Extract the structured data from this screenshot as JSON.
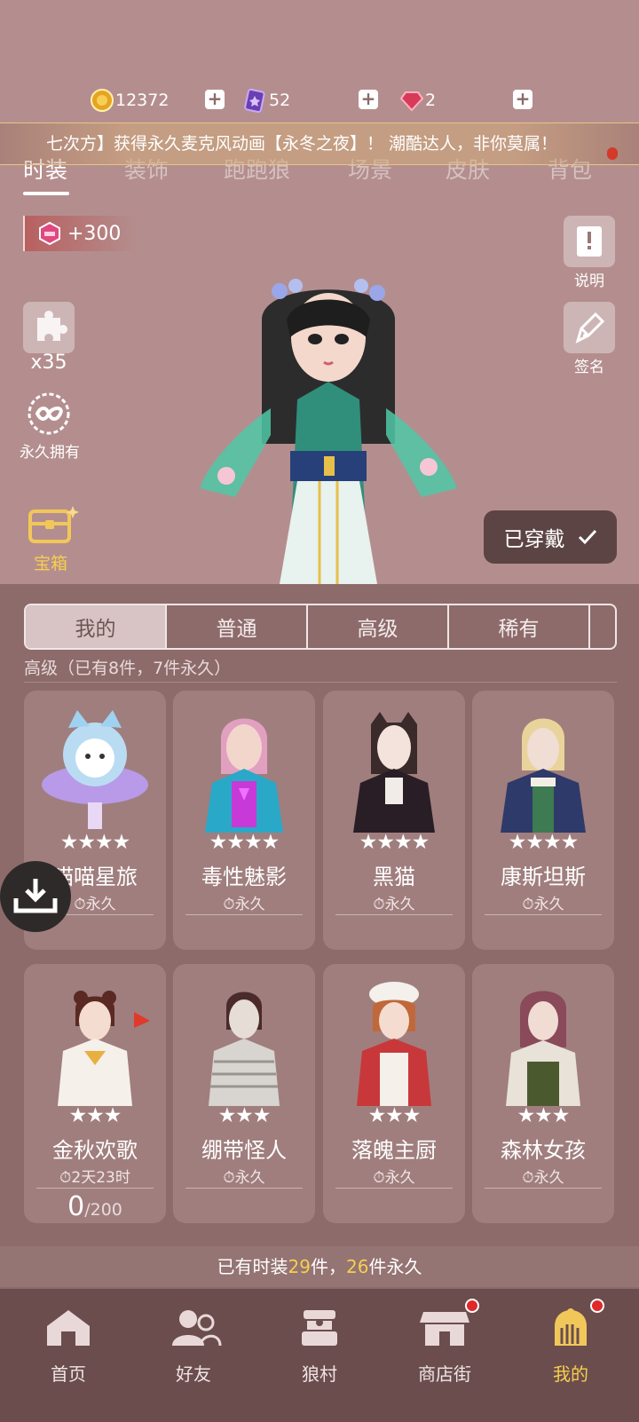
{
  "currency": [
    {
      "icon": "gold-coin-icon",
      "value": "12372"
    },
    {
      "icon": "purple-card-icon",
      "value": "52"
    },
    {
      "icon": "red-gem-icon",
      "value": "2"
    }
  ],
  "announcement": "七次方】获得永久麦克风动画【永冬之夜】！ 潮酷达人，非你莫属！",
  "top_tabs": [
    "时装",
    "装饰",
    "跑跑狼",
    "场景",
    "皮肤",
    "背包"
  ],
  "bonus": "+300",
  "side_left": {
    "puzzle_count": "x35",
    "permanent_label": "永久拥有",
    "chest_label": "宝箱"
  },
  "side_right": {
    "info_label": "说明",
    "sign_label": "签名"
  },
  "worn_button": "已穿戴",
  "filters": [
    "我的",
    "普通",
    "高级",
    "稀有"
  ],
  "section_header": "高级（已有8件，7件永久）",
  "cards": [
    {
      "name": "喵喵星旅",
      "stars": "★★★★",
      "status": "永久"
    },
    {
      "name": "毒性魅影",
      "stars": "★★★★",
      "status": "永久"
    },
    {
      "name": "黑猫",
      "stars": "★★★★",
      "status": "永久"
    },
    {
      "name": "康斯坦斯",
      "stars": "★★★★",
      "status": "永久"
    },
    {
      "name": "金秋欢歌",
      "stars": "★★★",
      "status": "2天23时",
      "progress_current": "0",
      "progress_total": "/200"
    },
    {
      "name": "绷带怪人",
      "stars": "★★★",
      "status": "永久"
    },
    {
      "name": "落魄主厨",
      "stars": "★★★",
      "status": "永久"
    },
    {
      "name": "森林女孩",
      "stars": "★★★",
      "status": "永久"
    }
  ],
  "summary": {
    "prefix": "已有时装",
    "total": "29",
    "mid": "件，",
    "permanent": "26",
    "suffix": "件永久"
  },
  "nav": [
    {
      "label": "首页",
      "icon": "home-icon"
    },
    {
      "label": "好友",
      "icon": "friends-icon"
    },
    {
      "label": "狼村",
      "icon": "village-icon"
    },
    {
      "label": "商店街",
      "icon": "shop-icon"
    },
    {
      "label": "我的",
      "icon": "profile-icon"
    }
  ],
  "colors": {
    "accent_gold": "#f5cf4e",
    "background": "#b48e8e",
    "panel": "#8d6b6b",
    "nav": "#6b4d4d"
  }
}
